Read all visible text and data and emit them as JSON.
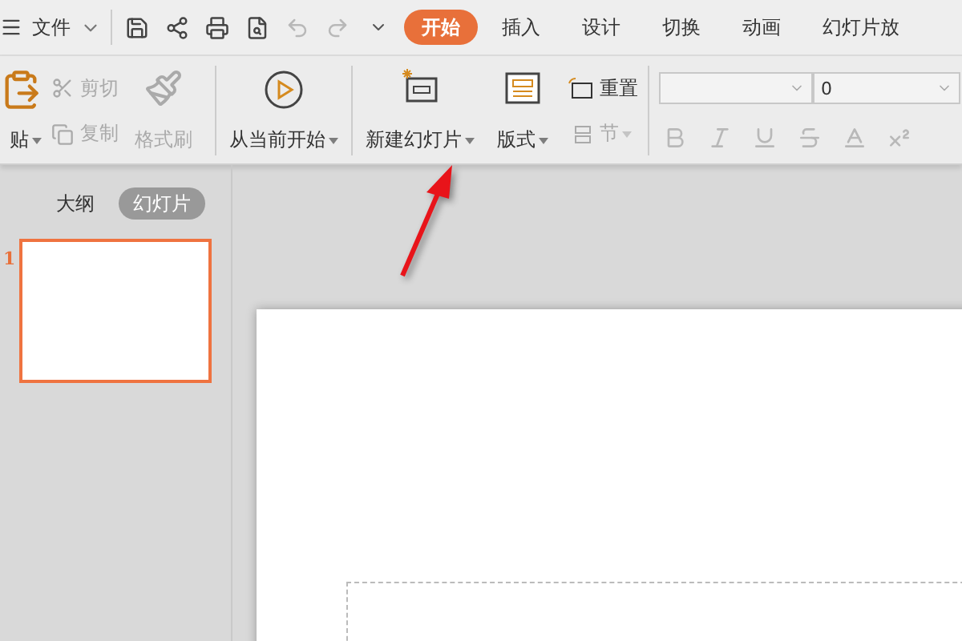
{
  "menu": {
    "label": "文件"
  },
  "quick_access": [
    {
      "disabled": false
    },
    {
      "disabled": false
    },
    {
      "disabled": false
    },
    {
      "disabled": false
    },
    {
      "disabled": true
    },
    {
      "disabled": true
    }
  ],
  "tabs": [
    {
      "label": "开始",
      "selected": true
    },
    {
      "label": "插入",
      "selected": false
    },
    {
      "label": "设计",
      "selected": false
    },
    {
      "label": "切换",
      "selected": false
    },
    {
      "label": "动画",
      "selected": false
    },
    {
      "label": "幻灯片放",
      "selected": false
    }
  ],
  "ribbon": {
    "paste": {
      "label": "贴"
    },
    "cut": {
      "label": "剪切",
      "disabled": true
    },
    "copy": {
      "label": "复制",
      "disabled": true
    },
    "format_painter": {
      "label": "格式刷",
      "disabled": true
    },
    "play_from_current": {
      "label": "从当前开始"
    },
    "new_slide": {
      "label": "新建幻灯片"
    },
    "layout": {
      "label": "版式"
    },
    "reset": {
      "label": "重置",
      "disabled": false
    },
    "section": {
      "label": "节",
      "disabled": true
    },
    "font_size": {
      "value": "0"
    },
    "format_buttons": [
      {
        "disabled": true
      },
      {
        "disabled": true
      },
      {
        "disabled": true
      },
      {
        "disabled": true
      },
      {
        "disabled": true
      },
      {
        "disabled": true
      }
    ]
  },
  "side_tabs": [
    {
      "label": "大纲",
      "selected": false
    },
    {
      "label": "幻灯片",
      "selected": true
    }
  ],
  "slides": [
    {
      "number": "1",
      "selected": true
    }
  ]
}
